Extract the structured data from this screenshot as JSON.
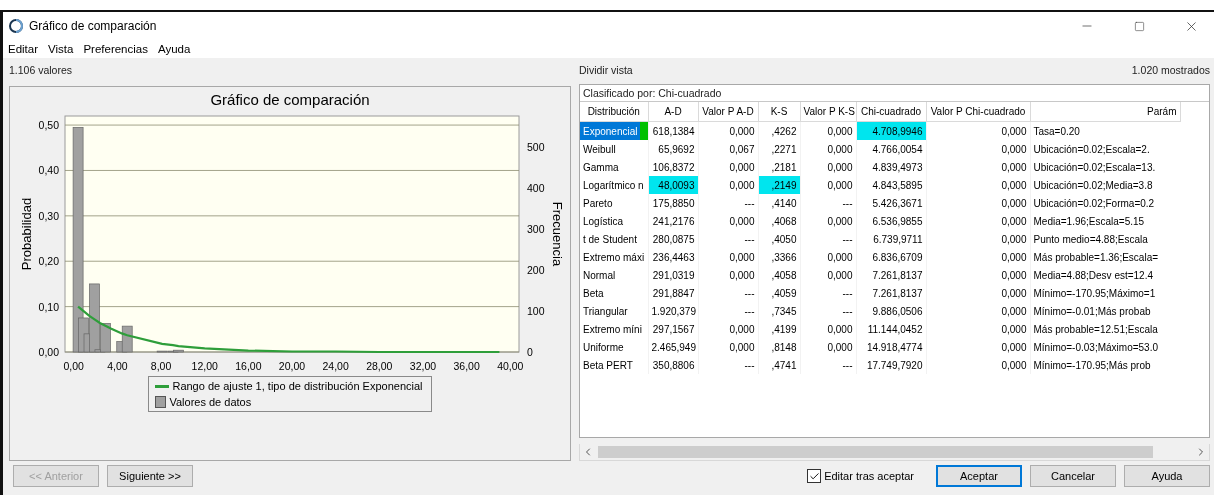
{
  "window": {
    "title": "Gráfico de comparación"
  },
  "menu": [
    "Editar",
    "Vista",
    "Preferencias",
    "Ayuda"
  ],
  "values_count": "1.106 valores",
  "split_view": "Dividir vista",
  "shown_count": "1.020 mostrados",
  "chart": {
    "chart_data": {
      "type": "bar",
      "grid": true,
      "title": "Gráfico de comparación",
      "ylabel": "Probabilidad",
      "xlim": [
        -0.8,
        40.8
      ],
      "ylim": [
        0,
        0.52
      ],
      "xticks": [
        {
          "value": 0,
          "label": "0,00"
        },
        {
          "value": 4,
          "label": "4,00"
        },
        {
          "value": 8,
          "label": "8,00"
        },
        {
          "value": 12,
          "label": "12,00"
        },
        {
          "value": 16,
          "label": "16,00"
        },
        {
          "value": 20,
          "label": "20,00"
        },
        {
          "value": 24,
          "label": "24,00"
        },
        {
          "value": 28,
          "label": "28,00"
        },
        {
          "value": 32,
          "label": "32,00"
        },
        {
          "value": 36,
          "label": "36,00"
        },
        {
          "value": 40,
          "label": "40,00"
        }
      ],
      "yticks": [
        {
          "value": 0,
          "label": "0,00"
        },
        {
          "value": 0.1,
          "label": "0,10"
        },
        {
          "value": 0.2,
          "label": "0,20"
        },
        {
          "value": 0.3,
          "label": "0,30"
        },
        {
          "value": 0.4,
          "label": "0,40"
        },
        {
          "value": 0.5,
          "label": "0,50"
        }
      ],
      "x": [
        0.4,
        0.9,
        1.4,
        1.9,
        2.4,
        2.9,
        3.4,
        4.4,
        4.9,
        8.1,
        9.1,
        9.6,
        12,
        16,
        20,
        24,
        28,
        32,
        36,
        39
      ],
      "series": [
        {
          "name": "Valores de datos",
          "type": "bar",
          "color": "#a0a0a0",
          "values": [
            0.495,
            0.075,
            0.04,
            0.15,
            0.005,
            0.063,
            null,
            0.023,
            0.057,
            0.002,
            0.002,
            0.004,
            null,
            null,
            null,
            null,
            null,
            null,
            null,
            null
          ]
        },
        {
          "name": "Rango de ajuste 1, tipo de distribución Exponencial",
          "type": "line",
          "color": "#2e9e3a",
          "values": [
            0.1,
            0.09,
            0.08,
            0.072,
            0.064,
            0.058,
            0.052,
            0.041,
            0.037,
            0.018,
            0.015,
            0.013,
            0.008,
            0.003,
            0.001,
            0.001,
            0.0,
            0.0,
            0.0,
            0.0
          ]
        }
      ]
    },
    "secondary_axis": {
      "label": "Frecuencia",
      "ticks": [
        "500",
        "400",
        "300",
        "200",
        "100",
        "0"
      ]
    }
  },
  "table": {
    "sorted_by": "Clasificado por: Chi-cuadrado",
    "columns": [
      "Distribución",
      "A-D",
      "Valor P A-D",
      "K-S",
      "Valor P K-S",
      "Chi-cuadrado",
      "Valor P Chi-cuadrado",
      "Parám"
    ],
    "rows": [
      {
        "selected": true,
        "cells": [
          {
            "text": "Exponencial",
            "best": false
          },
          {
            "text": "618,1384",
            "best": false
          },
          {
            "text": "0,000",
            "best": false
          },
          {
            "text": ",4262",
            "best": false
          },
          {
            "text": "0,000",
            "best": false
          },
          {
            "text": "4.708,9946",
            "best": true
          },
          {
            "text": "0,000",
            "best": false
          },
          {
            "text": "Tasa=0.20",
            "best": false
          }
        ]
      },
      {
        "selected": false,
        "cells": [
          {
            "text": "Weibull",
            "best": false
          },
          {
            "text": "65,9692",
            "best": false
          },
          {
            "text": "0,067",
            "best": false
          },
          {
            "text": ",2271",
            "best": false
          },
          {
            "text": "0,000",
            "best": false
          },
          {
            "text": "4.766,0054",
            "best": false
          },
          {
            "text": "0,000",
            "best": false
          },
          {
            "text": "Ubicación=0.02;Escala=2.",
            "best": false
          }
        ]
      },
      {
        "selected": false,
        "cells": [
          {
            "text": "Gamma",
            "best": false
          },
          {
            "text": "106,8372",
            "best": false
          },
          {
            "text": "0,000",
            "best": false
          },
          {
            "text": ",2181",
            "best": false
          },
          {
            "text": "0,000",
            "best": false
          },
          {
            "text": "4.839,4973",
            "best": false
          },
          {
            "text": "0,000",
            "best": false
          },
          {
            "text": "Ubicación=0.02;Escala=13.",
            "best": false
          }
        ]
      },
      {
        "selected": false,
        "cells": [
          {
            "text": "Logarítmico n",
            "best": false
          },
          {
            "text": "48,0093",
            "best": true
          },
          {
            "text": "0,000",
            "best": false
          },
          {
            "text": ",2149",
            "best": true
          },
          {
            "text": "0,000",
            "best": false
          },
          {
            "text": "4.843,5895",
            "best": false
          },
          {
            "text": "0,000",
            "best": false
          },
          {
            "text": "Ubicación=0.02;Media=3.8",
            "best": false
          }
        ]
      },
      {
        "selected": false,
        "cells": [
          {
            "text": "Pareto",
            "best": false
          },
          {
            "text": "175,8850",
            "best": false
          },
          {
            "text": "---",
            "best": false
          },
          {
            "text": ",4140",
            "best": false
          },
          {
            "text": "---",
            "best": false
          },
          {
            "text": "5.426,3671",
            "best": false
          },
          {
            "text": "0,000",
            "best": false
          },
          {
            "text": "Ubicación=0.02;Forma=0.2",
            "best": false
          }
        ]
      },
      {
        "selected": false,
        "cells": [
          {
            "text": "Logística",
            "best": false
          },
          {
            "text": "241,2176",
            "best": false
          },
          {
            "text": "0,000",
            "best": false
          },
          {
            "text": ",4068",
            "best": false
          },
          {
            "text": "0,000",
            "best": false
          },
          {
            "text": "6.536,9855",
            "best": false
          },
          {
            "text": "0,000",
            "best": false
          },
          {
            "text": "Media=1.96;Escala=5.15",
            "best": false
          }
        ]
      },
      {
        "selected": false,
        "cells": [
          {
            "text": "t de Student",
            "best": false
          },
          {
            "text": "280,0875",
            "best": false
          },
          {
            "text": "---",
            "best": false
          },
          {
            "text": ",4050",
            "best": false
          },
          {
            "text": "---",
            "best": false
          },
          {
            "text": "6.739,9711",
            "best": false
          },
          {
            "text": "0,000",
            "best": false
          },
          {
            "text": "Punto medio=4.88;Escala",
            "best": false
          }
        ]
      },
      {
        "selected": false,
        "cells": [
          {
            "text": "Extremo máxi",
            "best": false
          },
          {
            "text": "236,4463",
            "best": false
          },
          {
            "text": "0,000",
            "best": false
          },
          {
            "text": ",3366",
            "best": false
          },
          {
            "text": "0,000",
            "best": false
          },
          {
            "text": "6.836,6709",
            "best": false
          },
          {
            "text": "0,000",
            "best": false
          },
          {
            "text": "Más probable=1.36;Escala=",
            "best": false
          }
        ]
      },
      {
        "selected": false,
        "cells": [
          {
            "text": "Normal",
            "best": false
          },
          {
            "text": "291,0319",
            "best": false
          },
          {
            "text": "0,000",
            "best": false
          },
          {
            "text": ",4058",
            "best": false
          },
          {
            "text": "0,000",
            "best": false
          },
          {
            "text": "7.261,8137",
            "best": false
          },
          {
            "text": "0,000",
            "best": false
          },
          {
            "text": "Media=4.88;Desv est=12.4",
            "best": false
          }
        ]
      },
      {
        "selected": false,
        "cells": [
          {
            "text": "Beta",
            "best": false
          },
          {
            "text": "291,8847",
            "best": false
          },
          {
            "text": "---",
            "best": false
          },
          {
            "text": ",4059",
            "best": false
          },
          {
            "text": "---",
            "best": false
          },
          {
            "text": "7.261,8137",
            "best": false
          },
          {
            "text": "0,000",
            "best": false
          },
          {
            "text": "Mínimo=-170.95;Máximo=1",
            "best": false
          }
        ]
      },
      {
        "selected": false,
        "cells": [
          {
            "text": "Triangular",
            "best": false
          },
          {
            "text": "1.920,379",
            "best": false
          },
          {
            "text": "---",
            "best": false
          },
          {
            "text": ",7345",
            "best": false
          },
          {
            "text": "---",
            "best": false
          },
          {
            "text": "9.886,0506",
            "best": false
          },
          {
            "text": "0,000",
            "best": false
          },
          {
            "text": "Mínimo=-0.01;Más probab",
            "best": false
          }
        ]
      },
      {
        "selected": false,
        "cells": [
          {
            "text": "Extremo míni",
            "best": false
          },
          {
            "text": "297,1567",
            "best": false
          },
          {
            "text": "0,000",
            "best": false
          },
          {
            "text": ",4199",
            "best": false
          },
          {
            "text": "0,000",
            "best": false
          },
          {
            "text": "11.144,0452",
            "best": false
          },
          {
            "text": "0,000",
            "best": false
          },
          {
            "text": "Más probable=12.51;Escala",
            "best": false
          }
        ]
      },
      {
        "selected": false,
        "cells": [
          {
            "text": "Uniforme",
            "best": false
          },
          {
            "text": "2.465,949",
            "best": false
          },
          {
            "text": "0,000",
            "best": false
          },
          {
            "text": ",8148",
            "best": false
          },
          {
            "text": "0,000",
            "best": false
          },
          {
            "text": "14.918,4774",
            "best": false
          },
          {
            "text": "0,000",
            "best": false
          },
          {
            "text": "Mínimo=-0.03;Máximo=53.0",
            "best": false
          }
        ]
      },
      {
        "selected": false,
        "cells": [
          {
            "text": "Beta PERT",
            "best": false
          },
          {
            "text": "350,8806",
            "best": false
          },
          {
            "text": "---",
            "best": false
          },
          {
            "text": ",4741",
            "best": false
          },
          {
            "text": "---",
            "best": false
          },
          {
            "text": "17.749,7920",
            "best": false
          },
          {
            "text": "0,000",
            "best": false
          },
          {
            "text": "Mínimo=-170.95;Más prob",
            "best": false
          }
        ]
      }
    ]
  },
  "footer": {
    "buttons": [
      {
        "label": "<< Anterior",
        "disabled": true,
        "default": false
      },
      {
        "label": "Siguiente >>",
        "disabled": false,
        "default": false
      }
    ],
    "checkbox": {
      "label": "Editar tras aceptar",
      "checked": true
    },
    "dialog_buttons": [
      {
        "label": "Aceptar",
        "disabled": false,
        "default": true
      },
      {
        "label": "Cancelar",
        "disabled": false,
        "default": false
      },
      {
        "label": "Ayuda",
        "disabled": false,
        "default": false
      }
    ]
  }
}
